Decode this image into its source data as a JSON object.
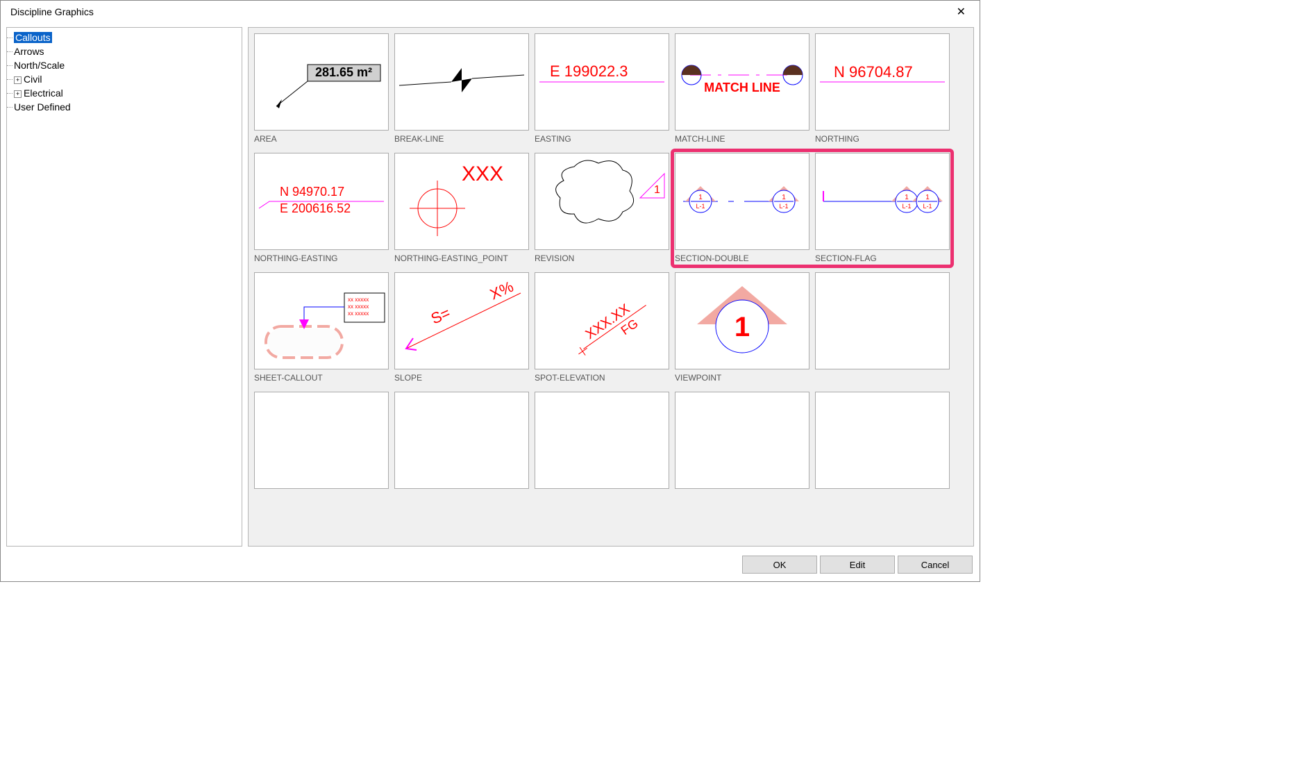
{
  "window": {
    "title": "Discipline Graphics"
  },
  "tree": {
    "items": [
      {
        "label": "Callouts",
        "selected": true
      },
      {
        "label": "Arrows"
      },
      {
        "label": "North/Scale"
      },
      {
        "label": "Civil",
        "expandable": true
      },
      {
        "label": "Electrical",
        "expandable": true
      },
      {
        "label": "User Defined"
      }
    ]
  },
  "gallery": {
    "items": [
      {
        "label": "AREA",
        "thumb": "area",
        "text1": "281.65 m²"
      },
      {
        "label": "BREAK-LINE",
        "thumb": "break-line"
      },
      {
        "label": "EASTING",
        "thumb": "easting",
        "text1": "E  199022.3"
      },
      {
        "label": "MATCH-LINE",
        "thumb": "match-line",
        "text1": "MATCH LINE"
      },
      {
        "label": "NORTHING",
        "thumb": "northing",
        "text1": "N  96704.87"
      },
      {
        "label": "NORTHING-EASTING",
        "thumb": "northing-easting",
        "text1": "N  94970.17",
        "text2": "E  200616.52"
      },
      {
        "label": "NORTHING-EASTING_POINT",
        "thumb": "ne-point",
        "text1": "XXX"
      },
      {
        "label": "REVISION",
        "thumb": "revision",
        "text1": "1"
      },
      {
        "label": "SECTION-DOUBLE",
        "thumb": "section-double",
        "text1": "1",
        "text2": "L-1"
      },
      {
        "label": "SECTION-FLAG",
        "thumb": "section-flag",
        "text1": "1",
        "text2": "L-1"
      },
      {
        "label": "SHEET-CALLOUT",
        "thumb": "sheet-callout",
        "text1": "xx xxxxx"
      },
      {
        "label": "SLOPE",
        "thumb": "slope",
        "text1": "S=",
        "text2": "X%"
      },
      {
        "label": "SPOT-ELEVATION",
        "thumb": "spot-elevation",
        "text1": "XXX.XX",
        "text2": "FG"
      },
      {
        "label": "VIEWPOINT",
        "thumb": "viewpoint",
        "text1": "1"
      },
      {
        "label": "",
        "thumb": "blank"
      },
      {
        "label": "",
        "thumb": "blank"
      },
      {
        "label": "",
        "thumb": "blank"
      },
      {
        "label": "",
        "thumb": "blank"
      },
      {
        "label": "",
        "thumb": "blank"
      },
      {
        "label": "",
        "thumb": "blank"
      }
    ]
  },
  "buttons": {
    "ok": "OK",
    "edit": "Edit",
    "cancel": "Cancel"
  },
  "highlight": {
    "row": 1,
    "colStart": 3,
    "colSpan": 2
  }
}
